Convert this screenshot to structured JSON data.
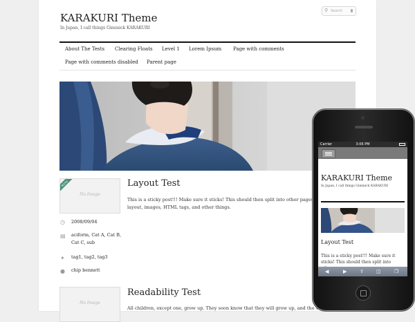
{
  "site": {
    "title": "KARAKURI Theme",
    "description": "In Japan, I call things Gimmick KARAKURI"
  },
  "search": {
    "placeholder": "Search"
  },
  "nav": {
    "items": [
      "About The Tests",
      "Clearing Floats",
      "Level 1",
      "Lorem Ipsum",
      "Page with comments",
      "Page with comments disabled",
      "Parent page"
    ]
  },
  "posts": [
    {
      "thumb_text": "No Image",
      "sticky_badge": "Sticky",
      "title": "Layout Test",
      "excerpt": "This is a sticky post!!! Make sure it sticks! This should then split into other pages with layout, images, HTML tags, and other things.",
      "date": "2008/09/04",
      "categories": "aciform, Cat A, Cat B, Cat C, sub",
      "tags": "tag1, tag2, tag3",
      "author": "chip bennett"
    },
    {
      "thumb_text": "No Image",
      "title": "Readability Test",
      "excerpt": "All children, except one, grow up. They soon know that they will grow up, and the way Wendy knew"
    }
  ],
  "icons": {
    "date": "clock-icon",
    "category": "folder-icon",
    "tag": "tag-icon",
    "author": "user-icon",
    "search": "magnifier-icon",
    "mic": "microphone-icon"
  },
  "mobile": {
    "status": {
      "carrier": "Carrier",
      "time": "3:06 PM"
    },
    "title": "KARAKURI Theme",
    "description": "In Japan, I call things Gimmick KARAKURI",
    "post_title": "Layout Test",
    "excerpt": "This is a sticky post!!! Make sure it sticks! This should then split into other pages"
  },
  "colors": {
    "accent_rule": "#111111",
    "sticky_badge": "#4a8f7c",
    "page_bg": "#efefef"
  }
}
